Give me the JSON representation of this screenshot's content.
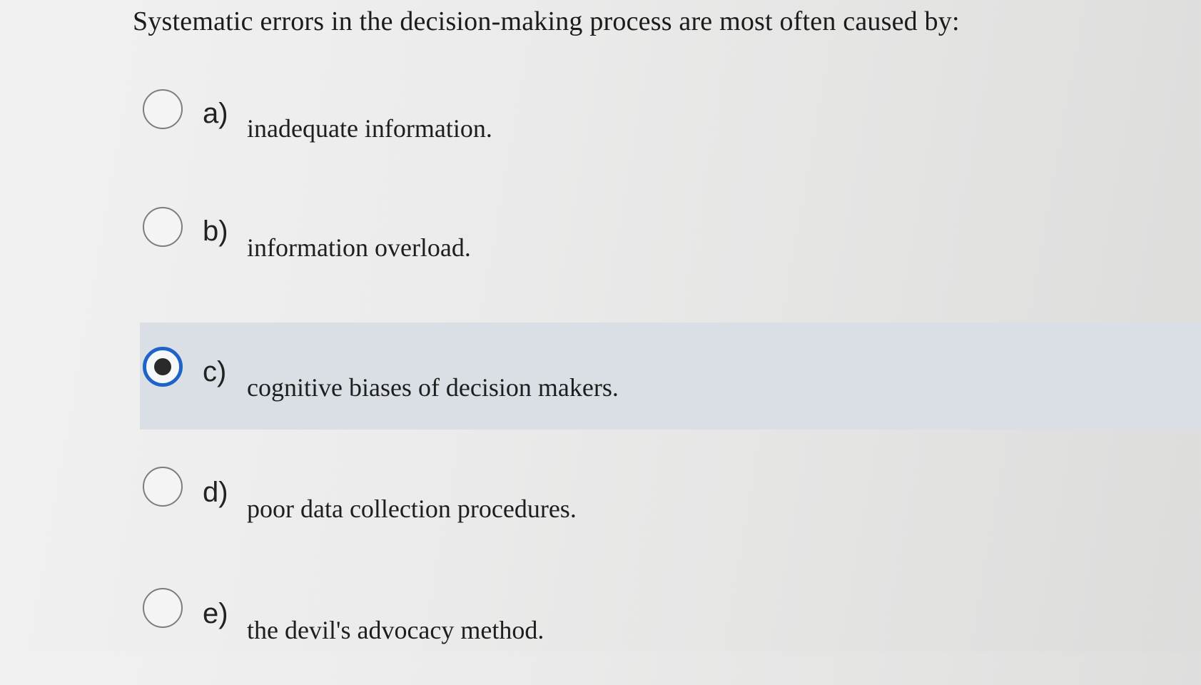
{
  "question": "Systematic errors in the decision-making process are most often caused by:",
  "options": [
    {
      "letter": "a)",
      "text": "inadequate information.",
      "selected": false
    },
    {
      "letter": "b)",
      "text": "information overload.",
      "selected": false
    },
    {
      "letter": "c)",
      "text": "cognitive biases of decision makers.",
      "selected": true
    },
    {
      "letter": "d)",
      "text": "poor data collection procedures.",
      "selected": false
    },
    {
      "letter": "e)",
      "text": "the devil's advocacy method.",
      "selected": false
    }
  ],
  "colors": {
    "selected_row_background": "#dadfe5",
    "selected_radio_border": "#1f63c8"
  }
}
